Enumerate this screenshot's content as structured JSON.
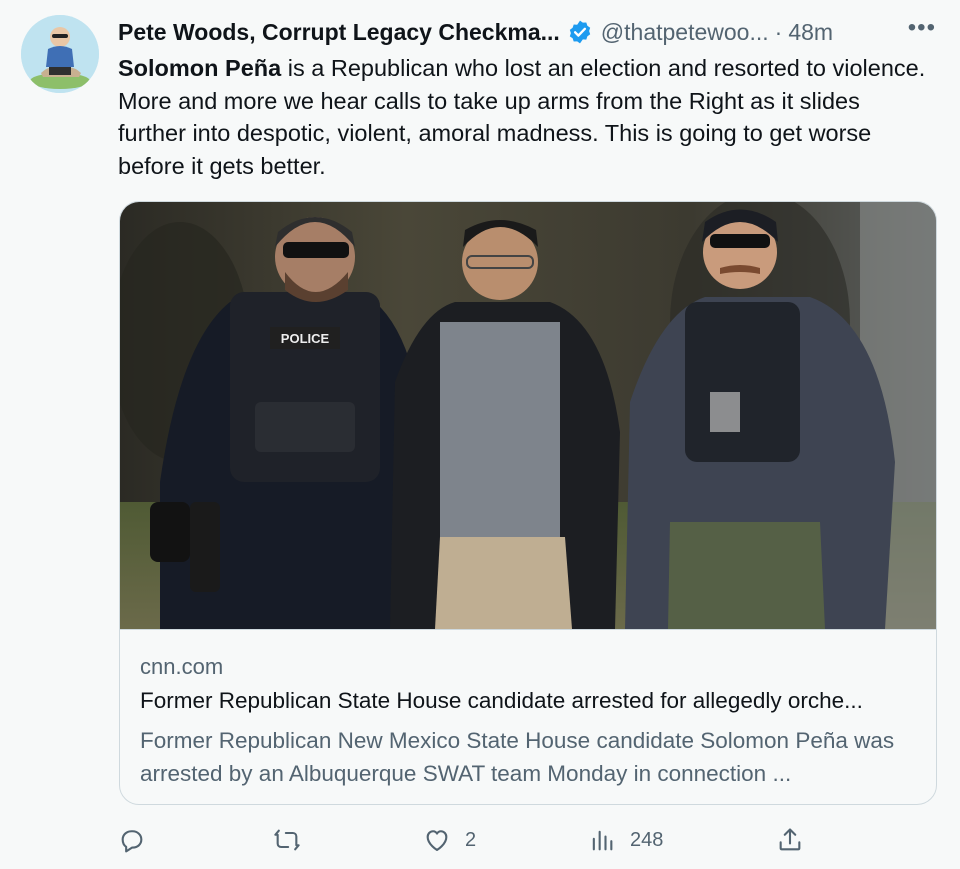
{
  "tweet": {
    "display_name": "Pete Woods, Corrupt Legacy Checkma...",
    "handle": "@thatpetewoo...",
    "separator": "·",
    "time": "48m",
    "more_label": "•••",
    "text_bold": "Solomon Peña",
    "text_rest": " is a Republican who lost an election and resorted to violence. More and more we hear calls to take up arms from the Right as it slides further into despotic, violent, amoral madness. This is going to get worse before it gets better."
  },
  "card": {
    "domain": "cnn.com",
    "title": "Former Republican State House candidate arrested for allegedly orche...",
    "description": "Former Republican New Mexico State House candidate Solomon Peña was arrested by an Albuquerque SWAT team Monday in connection ...",
    "image_patch_text": "POLICE"
  },
  "actions": {
    "reply": {
      "icon": "reply-icon",
      "count": ""
    },
    "retweet": {
      "icon": "retweet-icon",
      "count": ""
    },
    "like": {
      "icon": "heart-icon",
      "count": "2"
    },
    "views": {
      "icon": "views-icon",
      "count": "248"
    },
    "share": {
      "icon": "share-icon"
    }
  },
  "colors": {
    "verified": "#1d9bf0",
    "text_primary": "#0f1419",
    "text_secondary": "#536471",
    "border": "#cfd9de",
    "background": "#f7f9f9"
  }
}
